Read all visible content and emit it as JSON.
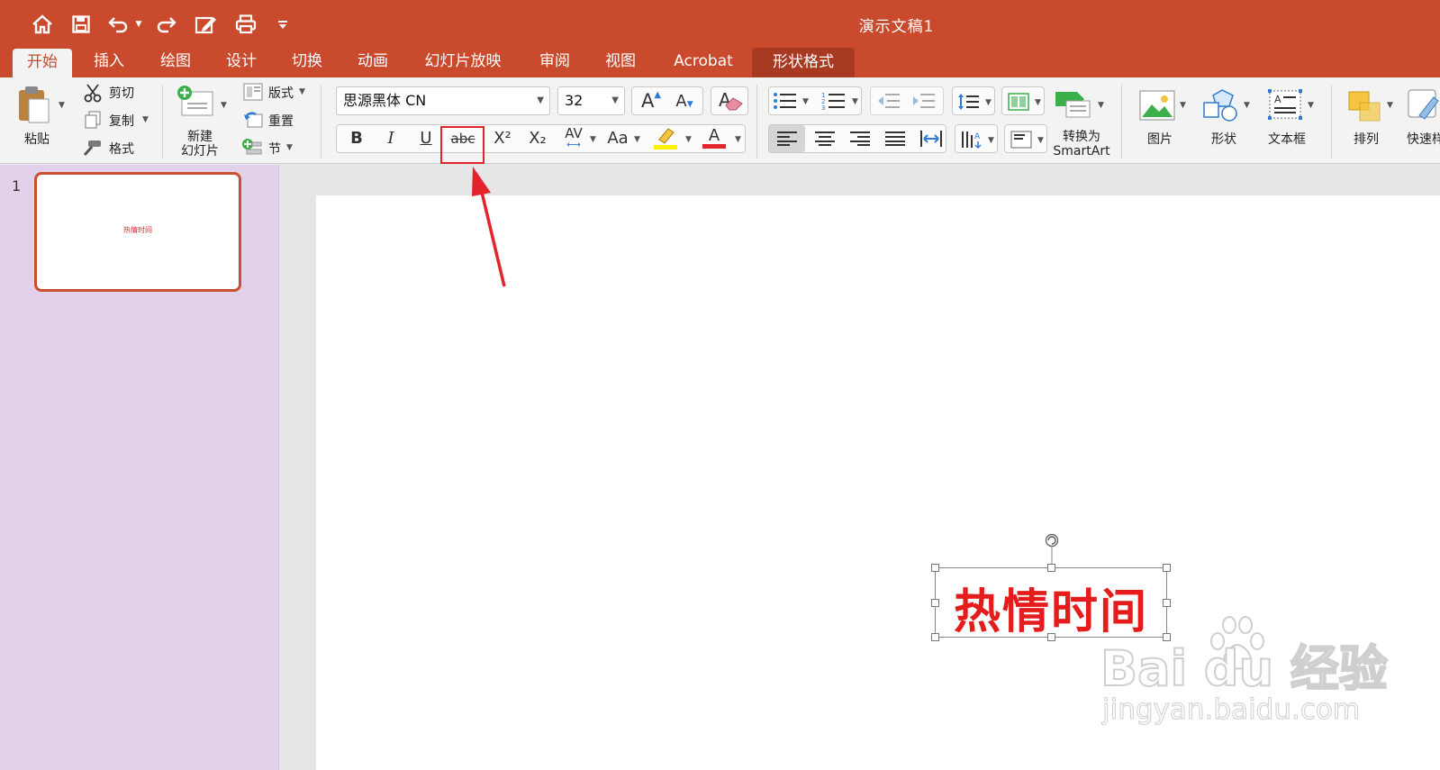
{
  "window": {
    "title": "演示文稿1"
  },
  "tabs": [
    "开始",
    "插入",
    "绘图",
    "设计",
    "切换",
    "动画",
    "幻灯片放映",
    "审阅",
    "视图",
    "Acrobat",
    "形状格式"
  ],
  "clipboard": {
    "paste": "粘贴",
    "cut": "剪切",
    "copy": "复制",
    "format": "格式"
  },
  "slides_group": {
    "new_slide_1": "新建",
    "new_slide_2": "幻灯片",
    "layout": "版式",
    "reset": "重置",
    "section": "节"
  },
  "font": {
    "name": "思源黑体 CN",
    "size": "32",
    "bold": "B",
    "italic": "I",
    "underline": "U",
    "strike": "abc",
    "superscript": "X²",
    "subscript": "X₂",
    "spacing": "AV",
    "case": "Aa",
    "grow": "A",
    "shrink": "A",
    "clear": "A"
  },
  "paragraph": {
    "smartart_1": "转换为",
    "smartart_2": "SmartArt"
  },
  "insert_group": {
    "picture": "图片",
    "shape": "形状",
    "textbox": "文本框",
    "arrange": "排列",
    "quick_styles": "快速样"
  },
  "slide_pane": {
    "number": "1",
    "thumb_text": "热情时间"
  },
  "slide": {
    "text": "热情时间"
  },
  "watermark": {
    "brand": "Bai du 经验",
    "url": "jingyan.baidu.com"
  },
  "colors": {
    "accent": "#c94a2c",
    "text_red": "#e51c1c",
    "highlight_yellow": "#ffee00",
    "font_red": "#e3242b",
    "pane": "#e3d1ec"
  }
}
